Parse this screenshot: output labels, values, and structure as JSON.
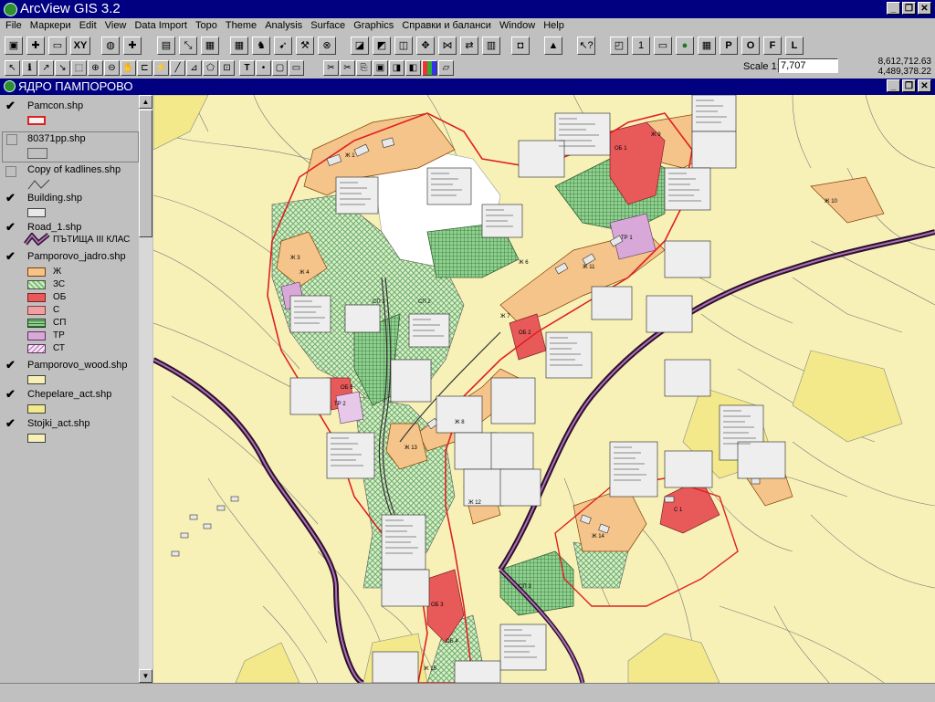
{
  "app": {
    "title": "ArcView GIS 3.2"
  },
  "menu": [
    "File",
    "Маркери",
    "Edit",
    "View",
    "Data Import",
    "Topo",
    "Theme",
    "Analysis",
    "Surface",
    "Graphics",
    "Справки и баланси",
    "Window",
    "Help"
  ],
  "toolbar": {
    "xy_label": "XY",
    "scale_label": "Scale 1:",
    "scale_value": "7,707",
    "coord_x": "8,612,712.63",
    "coord_y": "4,489,378.22",
    "letter_buttons": [
      "1",
      "P",
      "O",
      "F",
      "L"
    ]
  },
  "view": {
    "title": "ЯДРО ПАМПОРОВО"
  },
  "legend": {
    "themes": [
      {
        "name": "Pamcon.shp",
        "checked": true
      },
      {
        "name": "80371pp.shp",
        "checked": false
      },
      {
        "name": "Copy of kadlines.shp",
        "checked": false
      },
      {
        "name": "Building.shp",
        "checked": true
      },
      {
        "name": "Road_1.shp",
        "checked": true,
        "class": "ПЪТИЩА III КЛАС"
      },
      {
        "name": "Pamporovo_jadro.shp",
        "checked": true
      },
      {
        "name": "Pamporovo_wood.shp",
        "checked": true
      },
      {
        "name": "Chepelare_act.shp",
        "checked": true
      },
      {
        "name": "Stojki_act.shp",
        "checked": true
      }
    ],
    "zone_classes": [
      {
        "label": "Ж",
        "color": "#f5c48a"
      },
      {
        "label": "ЗС",
        "color": "#a8d49a"
      },
      {
        "label": "ОБ",
        "color": "#e85a5a"
      },
      {
        "label": "С",
        "color": "#f0a0a0"
      },
      {
        "label": "СП",
        "color": "#4f9a4f"
      },
      {
        "label": "ТР",
        "color": "#d8a8d8"
      },
      {
        "label": "СТ",
        "color": "#e8c8e8"
      }
    ]
  },
  "map": {
    "zone_labels": [
      "Ж 1",
      "Ж 3",
      "Ж 4",
      "СП 1",
      "СП 2",
      "Ж 6",
      "ТР 1",
      "Ж 11",
      "ОБ 1",
      "ОБ 2",
      "Ж 7",
      "Ж 8",
      "Ж 12",
      "ОБ 3",
      "Ж 13",
      "Ж 14",
      "С 1",
      "Ж 15",
      "ОБ 4",
      "СП 3",
      "ТР 2",
      "Ж 9",
      "Ж 10",
      "ОБ 5"
    ]
  }
}
